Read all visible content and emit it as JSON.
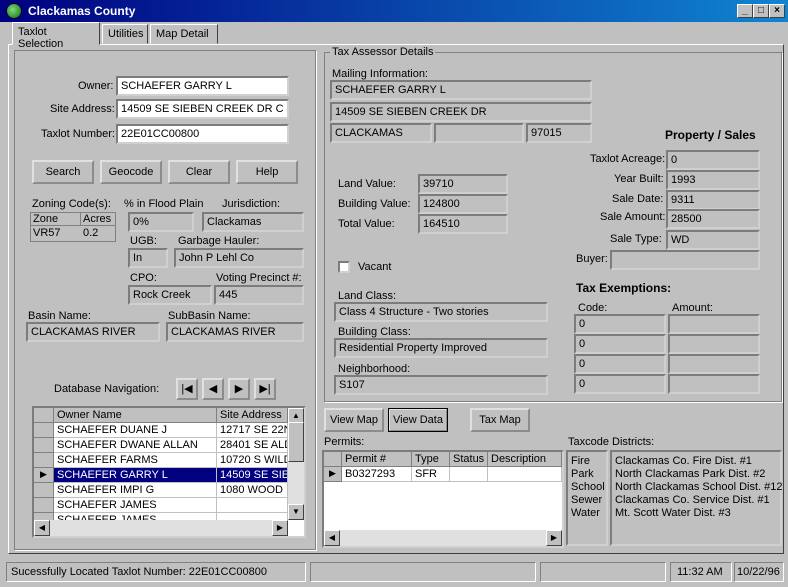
{
  "window": {
    "title": "Clackamas County"
  },
  "tabs": [
    "Taxlot Selection",
    "Utilities",
    "Map Detail"
  ],
  "search": {
    "owner_label": "Owner:",
    "owner": "SCHAEFER GARRY L",
    "site_label": "Site Address:",
    "site": "14509 SE SIEBEN CREEK DR     C",
    "taxlot_label": "Taxlot Number:",
    "taxlot": "22E01CC00800",
    "buttons": [
      "Search",
      "Geocode",
      "Clear",
      "Help"
    ]
  },
  "zoning": {
    "label": "Zoning Code(s):",
    "zone_hdr": "Zone",
    "acres_hdr": "Acres",
    "zone": "VR57",
    "acres": "0.2",
    "flood_label": "% in Flood Plain",
    "flood": "0%",
    "juris_label": "Jurisdiction:",
    "juris": "Clackamas",
    "ugb_label": "UGB:",
    "ugb": "In",
    "garbage_label": "Garbage Hauler:",
    "garbage": "John P Lehl Co",
    "cpo_label": "CPO:",
    "cpo": "Rock Creek",
    "voting_label": "Voting Precinct #:",
    "voting": "445",
    "basin_label": "Basin Name:",
    "basin": "CLACKAMAS RIVER",
    "subbasin_label": "SubBasin Name:",
    "subbasin": "CLACKAMAS RIVER"
  },
  "nav": {
    "label": "Database Navigation:"
  },
  "owner_grid": {
    "headers": [
      "Owner Name",
      "Site Address"
    ],
    "rows": [
      [
        "SCHAEFER DUANE J",
        "12717 SE 22N"
      ],
      [
        "SCHAEFER DWANE ALLAN",
        "28401 SE ALD"
      ],
      [
        "SCHAEFER FARMS",
        "10720 S  WILD"
      ],
      [
        "SCHAEFER GARRY L",
        "14509 SE SIEB"
      ],
      [
        "SCHAEFER IMPI G",
        "1080    WOOD"
      ],
      [
        "SCHAEFER JAMES",
        ""
      ],
      [
        "SCHAEFER JAMES",
        ""
      ]
    ]
  },
  "assessor": {
    "group_label": "Tax Assessor Details",
    "mailing_label": "Mailing Information:",
    "mail1": "SCHAEFER GARRY L",
    "mail2": "14509 SE SIEBEN CREEK DR",
    "city": "CLACKAMAS",
    "state": "",
    "zip": "97015",
    "land_label": "Land Value:",
    "land": "39710",
    "bldg_label": "Building Value:",
    "bldg": "124800",
    "total_label": "Total Value:",
    "total": "164510",
    "vacant_label": "Vacant",
    "landclass_label": "Land Class:",
    "landclass": "Class 4 Structure - Two stories",
    "bldgclass_label": "Building Class:",
    "bldgclass": "Residential Property Improved",
    "nbhd_label": "Neighborhood:",
    "nbhd": "S107",
    "prop_title": "Property / Sales",
    "acreage_label": "Taxlot Acreage:",
    "acreage": "0",
    "yearbuilt_label": "Year Built:",
    "yearbuilt": "1993",
    "saledate_label": "Sale Date:",
    "saledate": "9311",
    "saleamt_label": "Sale Amount:",
    "saleamt": "28500",
    "saletype_label": "Sale Type:",
    "saletype": "WD",
    "buyer_label": "Buyer:",
    "buyer": "",
    "exempt_title": "Tax Exemptions:",
    "code_label": "Code:",
    "amount_label": "Amount:",
    "exempt_codes": [
      "0",
      "0",
      "0",
      "0"
    ]
  },
  "view_buttons": [
    "View Map",
    "View Data",
    "Tax Map"
  ],
  "permits": {
    "label": "Permits:",
    "headers": [
      "Permit #",
      "Type",
      "Status",
      "Description"
    ],
    "row": [
      "B0327293",
      "SFR",
      "",
      ""
    ]
  },
  "taxcode": {
    "label": "Taxcode Districts:",
    "types": [
      "Fire",
      "Park",
      "School",
      "Sewer",
      "Water"
    ],
    "districts": [
      "Clackamas Co. Fire Dist. #1",
      "North Clackamas Park Dist. #2",
      "North Clackamas School Dist. #12",
      "Clackamas Co. Service Dist. #1",
      "Mt. Scott Water Dist. #3"
    ]
  },
  "status": {
    "message": "Sucessfully Located Taxlot Number: 22E01CC00800",
    "time": "11:32 AM",
    "date": "10/22/96"
  },
  "colors": {
    "title_bar": "#000080",
    "selection": "#000080",
    "face": "#c0c0c0"
  }
}
